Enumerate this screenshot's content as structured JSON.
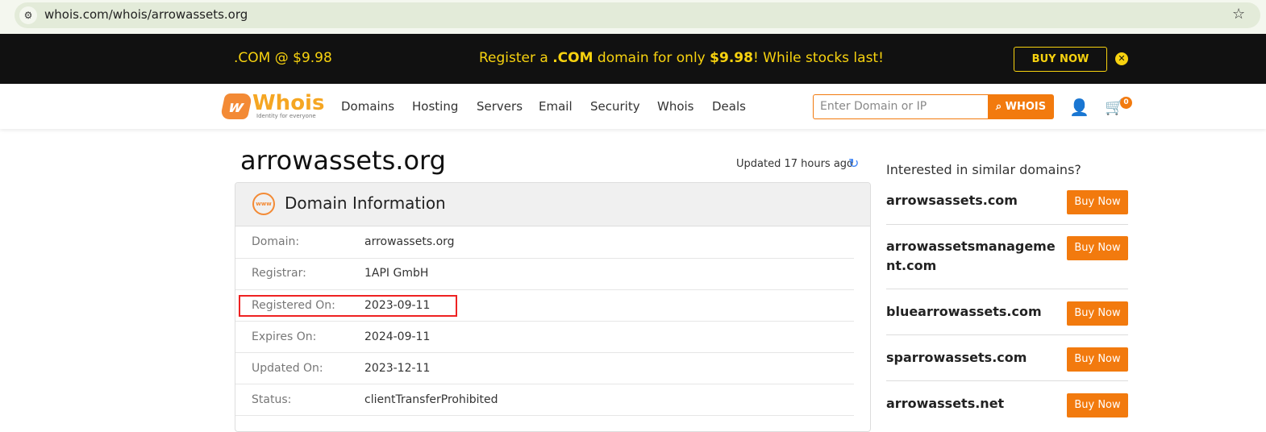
{
  "browser": {
    "url": "whois.com/whois/arrowassets.org"
  },
  "promo": {
    "left": ".COM @ $9.98",
    "mid_pre": "Register a ",
    "mid_bold1": ".COM",
    "mid_mid": " domain for only ",
    "mid_bold2": "$9.98",
    "mid_post": "! While stocks last!",
    "button": "BUY NOW"
  },
  "nav": {
    "logo": "Whois",
    "tagline": "Identity for everyone",
    "items": [
      "Domains",
      "Hosting",
      "Servers",
      "Email",
      "Security",
      "Whois",
      "Deals"
    ],
    "search_placeholder": "Enter Domain or IP",
    "search_button": "WHOIS",
    "cart_count": "0"
  },
  "page": {
    "title": "arrowassets.org",
    "updated": "Updated 17 hours ago"
  },
  "card": {
    "title": "Domain Information",
    "icon_text": "www",
    "rows": [
      {
        "label": "Domain:",
        "value": "arrowassets.org"
      },
      {
        "label": "Registrar:",
        "value": "1API GmbH"
      },
      {
        "label": "Registered On:",
        "value": "2023-09-11"
      },
      {
        "label": "Expires On:",
        "value": "2024-09-11"
      },
      {
        "label": "Updated On:",
        "value": "2023-12-11"
      },
      {
        "label": "Status:",
        "value": "clientTransferProhibited"
      }
    ]
  },
  "sidebar": {
    "title": "Interested in similar domains?",
    "button": "Buy Now",
    "items": [
      {
        "name": "arrowsassets.com"
      },
      {
        "name": "arrowassetsmanagement.com"
      },
      {
        "name": "bluearrowassets.com"
      },
      {
        "name": "sparrowassets.com"
      },
      {
        "name": "arrowassets.net"
      }
    ]
  },
  "colors": {
    "accent": "#f27a0e",
    "promo_text": "#f7d20f",
    "highlight": "#e22222"
  }
}
